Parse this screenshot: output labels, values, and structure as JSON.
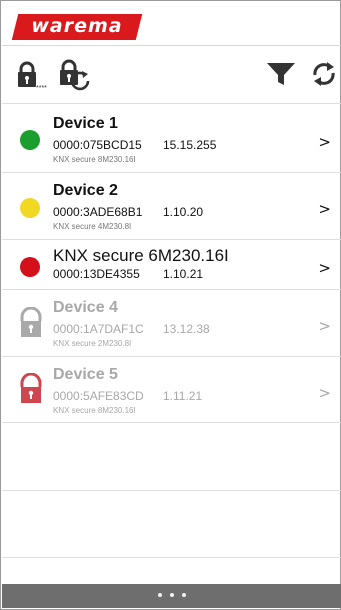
{
  "header": {
    "logo_text": "warema",
    "brand_color": "#d9191c"
  },
  "toolbar": {
    "lock_key_icon": "lock-key-icon",
    "lock_key_mask": "****",
    "lock_refresh_icon": "lock-refresh-icon",
    "filter_icon": "filter-icon",
    "refresh_icon": "refresh-icon"
  },
  "devices": [
    {
      "title": "Device 1",
      "address": "0000:075BCD15",
      "ip": "15.15.255",
      "type": "KNX secure 8M230.16I",
      "status": "green",
      "status_color": "#1c9e2e",
      "chevron": ">"
    },
    {
      "title": "Device 2",
      "address": "0000:3ADE68B1",
      "ip": "1.10.20",
      "type": "KNX secure 4M230.8I",
      "status": "yellow",
      "status_color": "#f1d822",
      "chevron": ">"
    },
    {
      "title": "KNX secure 6M230.16I",
      "address": "0000:13DE4355",
      "ip": "1.10.21",
      "type": "",
      "status": "red",
      "status_color": "#d4101a",
      "chevron": ">"
    },
    {
      "title": "Device 4",
      "address": "0000:1A7DAF1C",
      "ip": "13.12.38",
      "type": "KNX secure 2M230.8I",
      "status": "locked-gray",
      "status_color": "#a9a9a9",
      "chevron": ">"
    },
    {
      "title": "Device 5",
      "address": "0000:5AFE83CD",
      "ip": "1.11.21",
      "type": "KNX secure 8M230.16I",
      "status": "locked-red",
      "status_color": "#cf4651",
      "chevron": ">"
    }
  ],
  "pager": {
    "pages": 3
  }
}
